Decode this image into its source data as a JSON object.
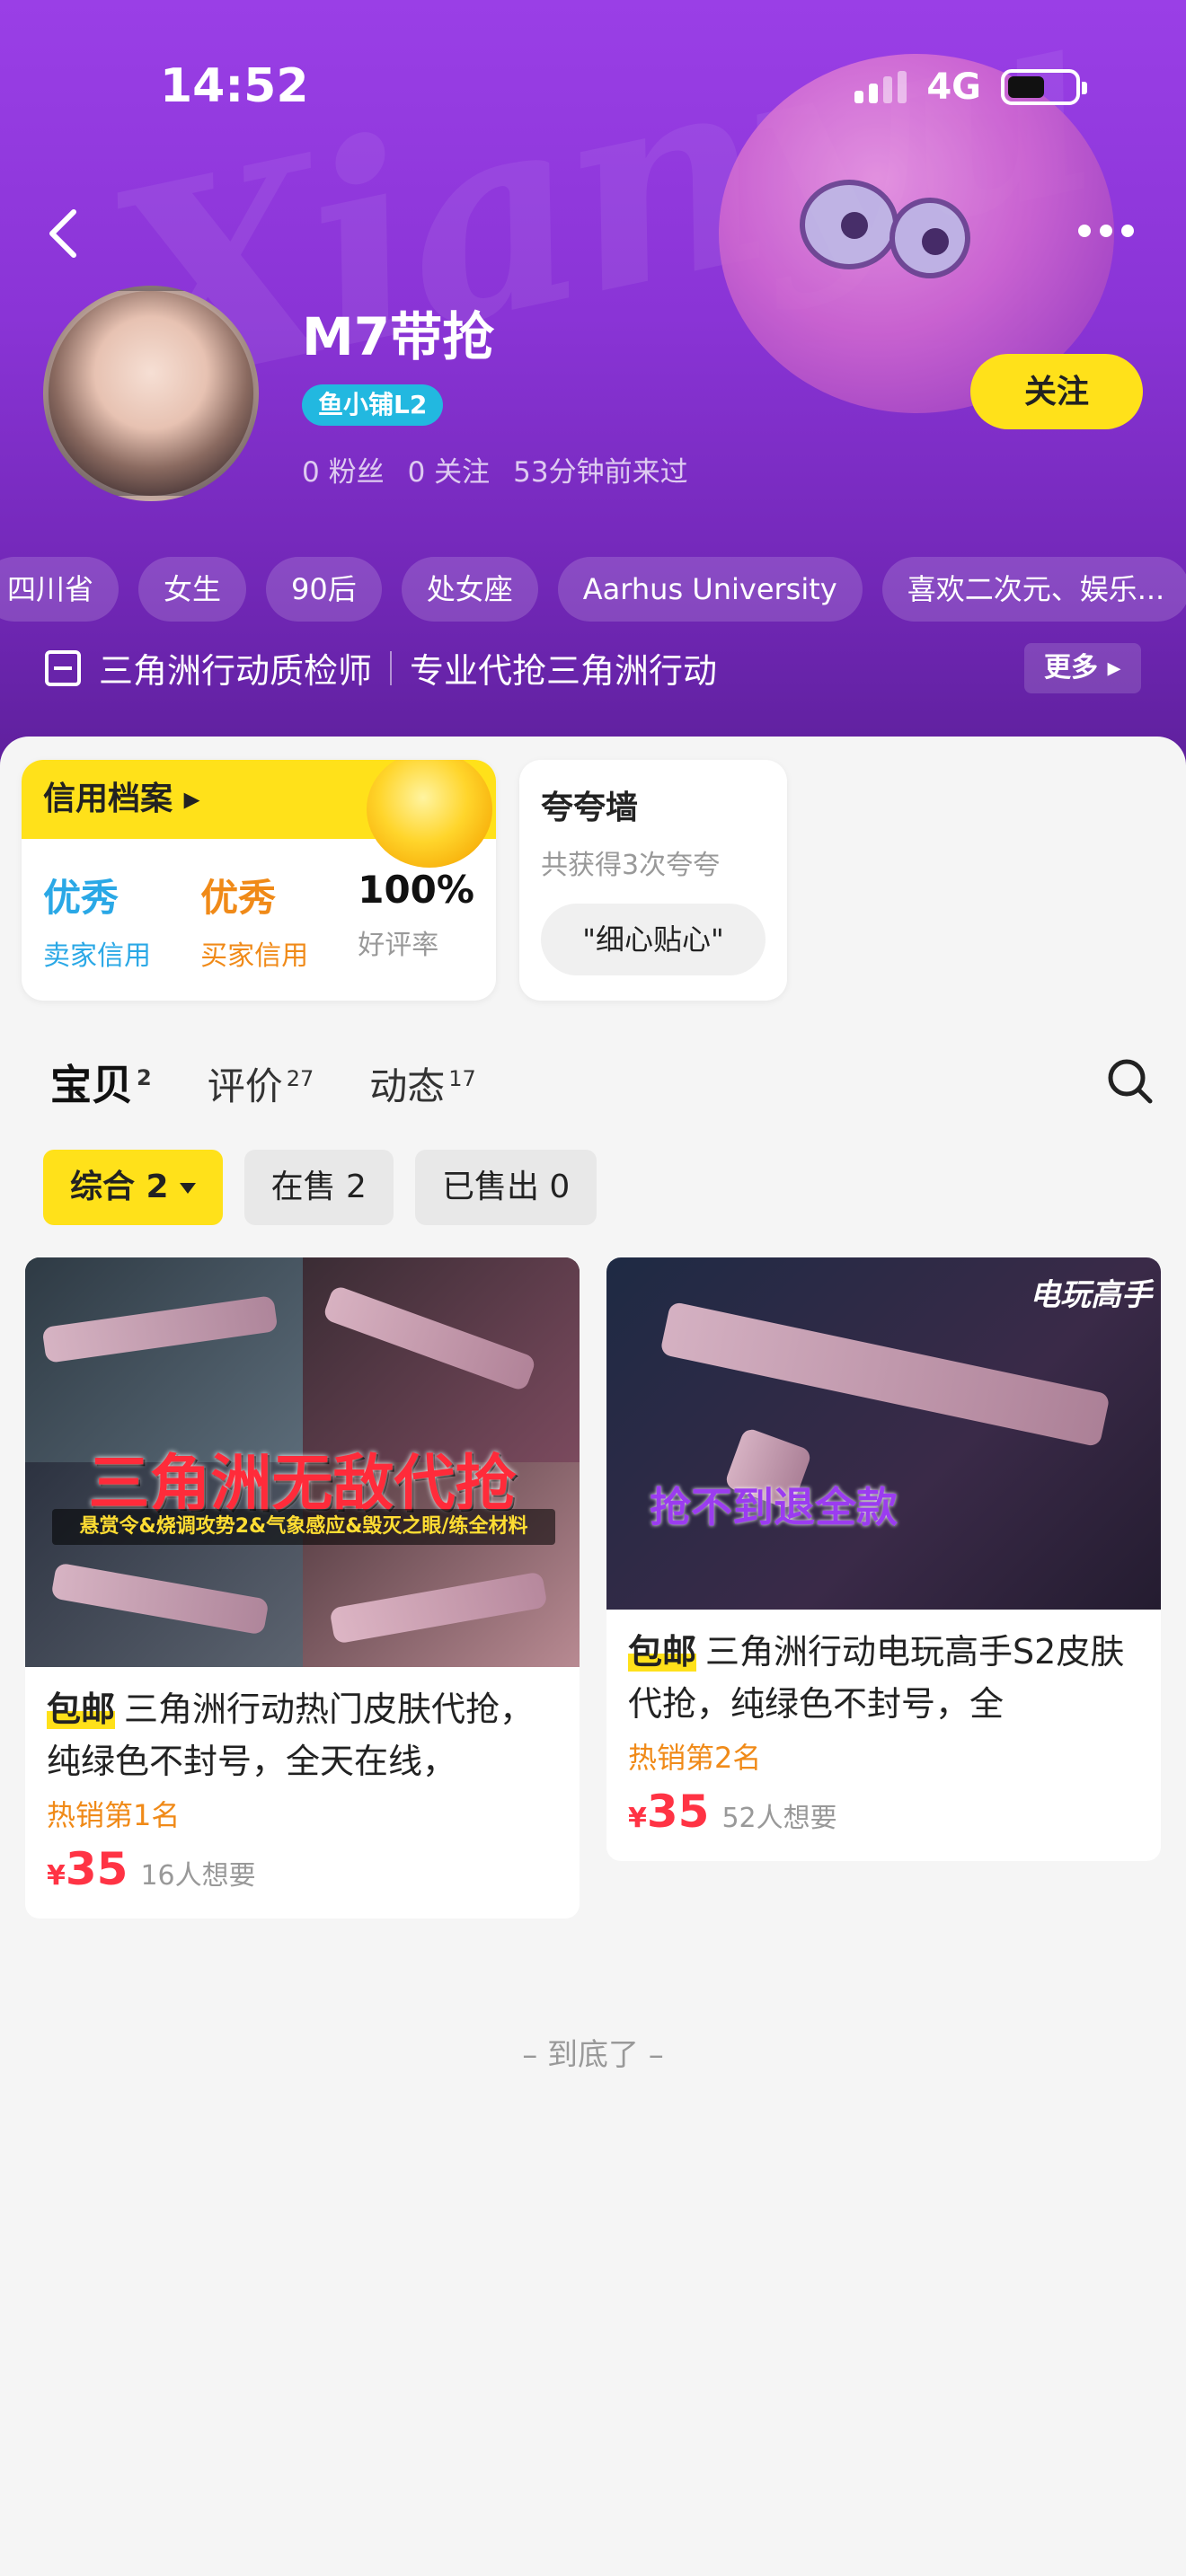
{
  "status_bar": {
    "time": "14:52",
    "network": "4G"
  },
  "header": {
    "username": "M7带抢",
    "level_badge": "鱼小铺L2",
    "stats": [
      "0 粉丝",
      "0 关注",
      "53分钟前来过"
    ],
    "follow_label": "关注",
    "watermark": "Xianyu",
    "tags": [
      "四川省",
      "女生",
      "90后",
      "处女座",
      "Aarhus University",
      "喜欢二次元、娱乐..."
    ],
    "shop_name": "三角洲行动质检师",
    "shop_desc": "专业代抢三角洲行动",
    "more_label": "更多"
  },
  "credit": {
    "title": "信用档案",
    "items": [
      {
        "value": "优秀",
        "label": "卖家信用",
        "color": "#2aa8e6"
      },
      {
        "value": "优秀",
        "label": "买家信用",
        "color": "#f08a18"
      },
      {
        "value": "100%",
        "label": "好评率"
      }
    ]
  },
  "praise": {
    "title": "夸夸墙",
    "subtitle": "共获得3次夸夸",
    "chip": "\"细心贴心\""
  },
  "tabs": [
    {
      "label": "宝贝",
      "count": "2"
    },
    {
      "label": "评价",
      "count": "27"
    },
    {
      "label": "动态",
      "count": "17"
    }
  ],
  "filters": [
    "综合 2",
    "在售 2",
    "已售出 0"
  ],
  "products": [
    {
      "image_title": "三角洲无敌代抢",
      "image_subtitle": "悬赏令&烧调攻势2&气象感应&毁灭之眼/练全材料",
      "ship_label": "包邮",
      "title": "三角洲行动热门皮肤代抢，纯绿色不封号，全天在线，",
      "rank": "热销第1名",
      "price": "35",
      "wants": "16人想要"
    },
    {
      "image_title": "抢不到退全款",
      "image_brand": "电玩高手",
      "ship_label": "包邮",
      "title": "三角洲行动电玩高手S2皮肤代抢，纯绿色不封号，全",
      "rank": "热销第2名",
      "price": "35",
      "wants": "52人想要"
    }
  ],
  "footer_note": "– 到底了 –",
  "colors": {
    "accent_yellow": "#ffe11a",
    "header_purple": "#8a34d6",
    "price_red": "#ff3344"
  }
}
